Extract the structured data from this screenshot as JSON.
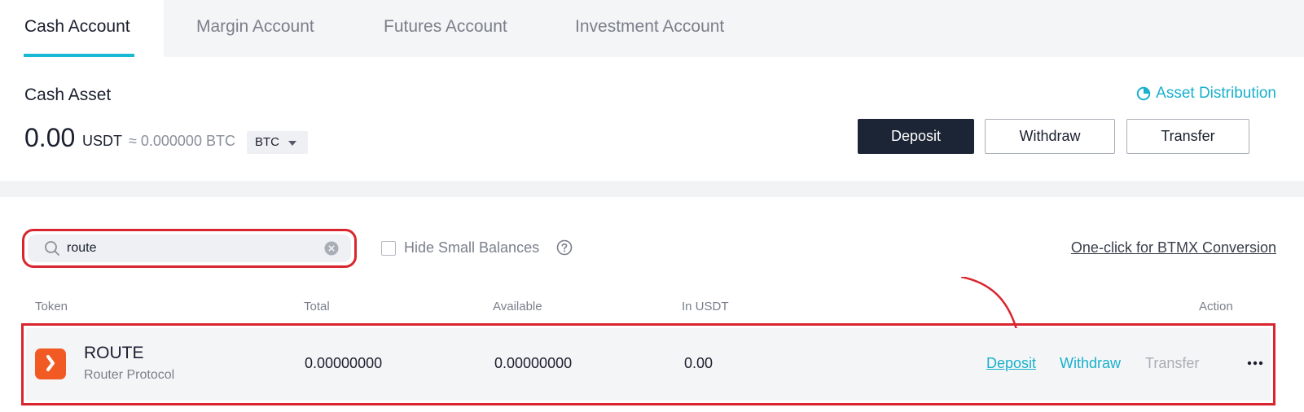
{
  "tabs": [
    {
      "label": "Cash Account",
      "active": true
    },
    {
      "label": "Margin Account",
      "active": false
    },
    {
      "label": "Futures Account",
      "active": false
    },
    {
      "label": "Investment Account",
      "active": false
    }
  ],
  "asset": {
    "title": "Cash Asset",
    "amount": "0.00",
    "unit": "USDT",
    "approx": "≈ 0.000000 BTC",
    "currency_select": "BTC",
    "distribution_link": "Asset Distribution"
  },
  "actions": {
    "deposit": "Deposit",
    "withdraw": "Withdraw",
    "transfer": "Transfer"
  },
  "filters": {
    "search_value": "route",
    "hide_small_label": "Hide Small Balances",
    "hide_small_checked": false,
    "btmx_link": "One-click for BTMX Conversion"
  },
  "table": {
    "headers": {
      "token": "Token",
      "total": "Total",
      "available": "Available",
      "in_usdt": "In USDT",
      "action": "Action"
    },
    "rows": [
      {
        "symbol": "ROUTE",
        "name": "Router Protocol",
        "total": "0.00000000",
        "available": "0.00000000",
        "in_usdt": "0.00",
        "deposit": "Deposit",
        "withdraw": "Withdraw",
        "transfer": "Transfer"
      }
    ]
  },
  "colors": {
    "accent": "#19b8d4",
    "primary_button": "#1b2535",
    "highlight": "#d9262e",
    "token_logo": "#f15a22"
  },
  "icons": {
    "distribution": "pie-chart-icon",
    "search": "search-icon",
    "clear": "clear-icon",
    "help": "help-icon",
    "more": "more-icon",
    "token": "router-protocol-logo-icon"
  }
}
